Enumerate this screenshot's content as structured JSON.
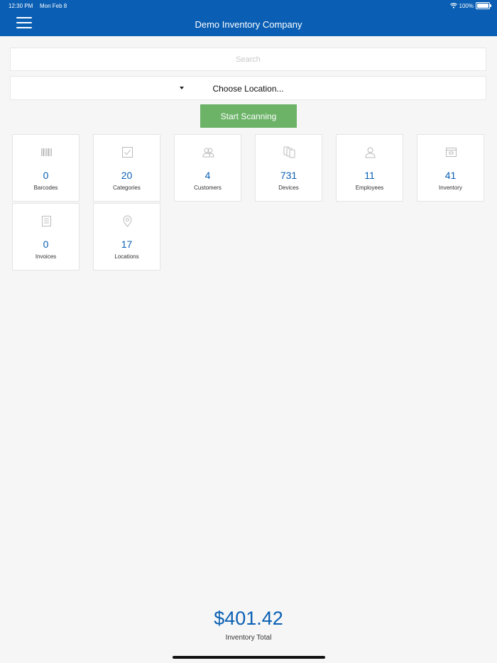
{
  "status_bar": {
    "time": "12:30 PM",
    "date": "Mon Feb 8",
    "battery": "100%"
  },
  "header": {
    "title": "Demo Inventory Company",
    "menu_icon": "hamburger-menu-icon"
  },
  "search": {
    "placeholder": "Search",
    "value": ""
  },
  "location": {
    "selected": "Choose Location..."
  },
  "scan_button": {
    "label": "Start Scanning"
  },
  "tiles": [
    {
      "value": "0",
      "label": "Barcodes",
      "icon": "barcode-icon"
    },
    {
      "value": "20",
      "label": "Categories",
      "icon": "checkbox-icon"
    },
    {
      "value": "4",
      "label": "Customers",
      "icon": "customers-icon"
    },
    {
      "value": "731",
      "label": "Devices",
      "icon": "devices-icon"
    },
    {
      "value": "11",
      "label": "Employees",
      "icon": "person-icon"
    },
    {
      "value": "41",
      "label": "Inventory",
      "icon": "box-icon"
    },
    {
      "value": "0",
      "label": "Invoices",
      "icon": "invoice-icon"
    },
    {
      "value": "17",
      "label": "Locations",
      "icon": "map-pin-icon"
    }
  ],
  "footer": {
    "total": "$401.42",
    "total_label": "Inventory Total"
  },
  "colors": {
    "brand_blue": "#0a5fb4",
    "scan_green": "#6cb368",
    "background": "#f6f6f6"
  }
}
